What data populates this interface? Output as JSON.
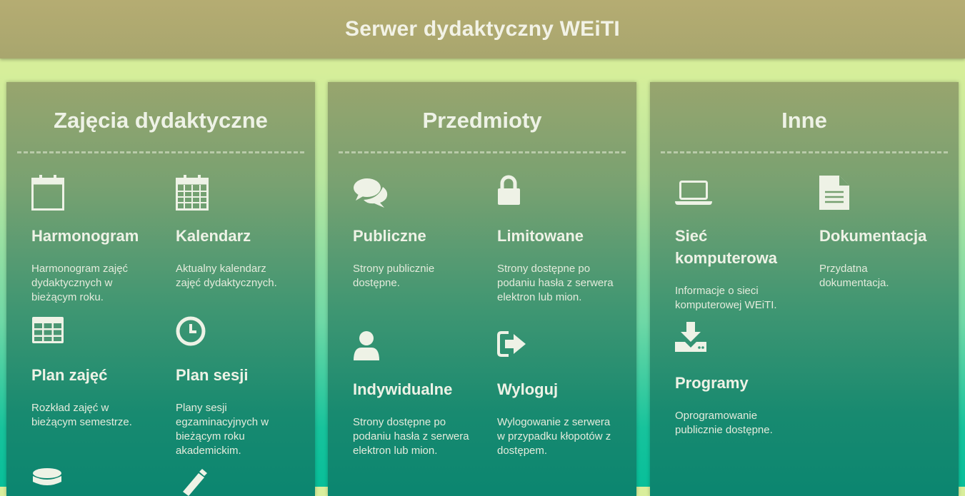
{
  "header": {
    "title": "Serwer dydaktyczny WEiTI"
  },
  "colors": {
    "header": "#b5ac72",
    "panel_top": "#98a56e",
    "panel_bottom": "#0b8670",
    "text": "#eef2e6"
  },
  "panels": [
    {
      "title": "Zajęcia dydaktyczne",
      "items": [
        {
          "icon": "calendar-empty-icon",
          "title": "Harmonogram",
          "desc": "Harmonogram zajęć dydaktycznych w bieżącym roku."
        },
        {
          "icon": "calendar-grid-icon",
          "title": "Kalendarz",
          "desc": "Aktualny kalendarz zajęć dydaktycznych."
        },
        {
          "icon": "table-icon",
          "title": "Plan zajęć",
          "desc": "Rozkład zajęć w bieżącym semestrze."
        },
        {
          "icon": "clock-icon",
          "title": "Plan sesji",
          "desc": "Plany sesji egzaminacyjnych w bieżącym roku akademickim."
        },
        {
          "icon": "database-icon",
          "title": "",
          "desc": ""
        },
        {
          "icon": "pencil-icon",
          "title": "",
          "desc": ""
        }
      ]
    },
    {
      "title": "Przedmioty",
      "items": [
        {
          "icon": "comments-icon",
          "title": "Publiczne",
          "desc": "Strony publicznie dostępne."
        },
        {
          "icon": "lock-icon",
          "title": "Limitowane",
          "desc": "Strony dostępne po podaniu hasła z serwera elektron lub mion."
        },
        {
          "icon": "user-icon",
          "title": "Indywidualne",
          "desc": "Strony dostępne po podaniu hasła z serwera elektron lub mion."
        },
        {
          "icon": "sign-out-icon",
          "title": "Wyloguj",
          "desc": "Wylogowanie z serwera w przypadku kłopotów z dostępem."
        }
      ]
    },
    {
      "title": "Inne",
      "items": [
        {
          "icon": "laptop-icon",
          "title": "Sieć komputerowa",
          "desc": "Informacje o sieci komputerowej WEiTI."
        },
        {
          "icon": "document-icon",
          "title": "Dokumentacja",
          "desc": "Przydatna dokumentacja."
        },
        {
          "icon": "download-icon",
          "title": "Programy",
          "desc": "Oprogramowanie publicznie dostępne."
        }
      ]
    }
  ]
}
